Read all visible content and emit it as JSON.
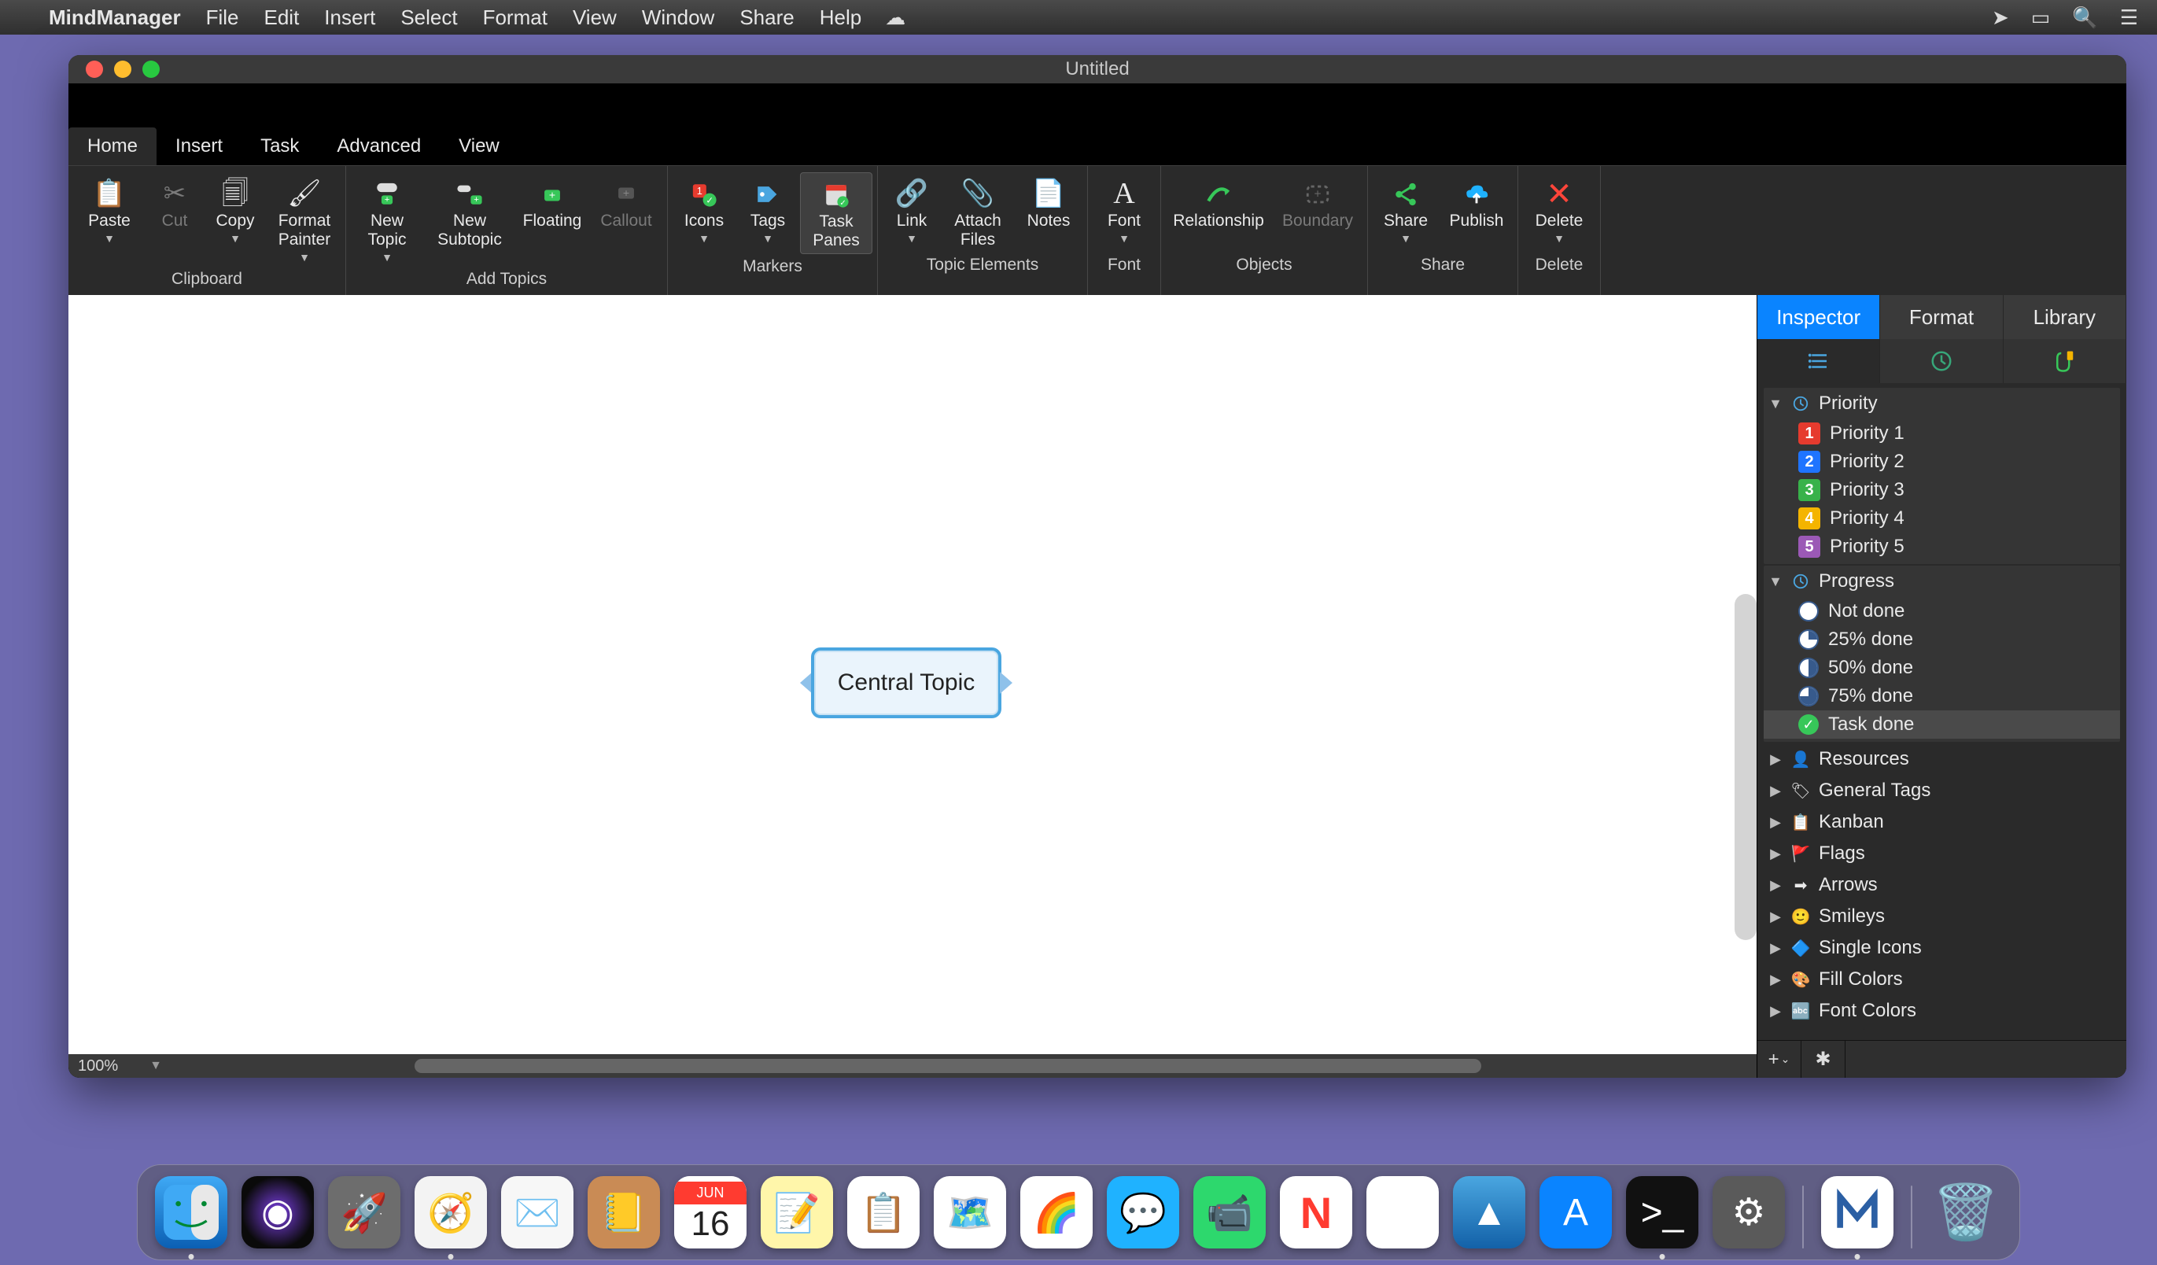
{
  "menubar": {
    "app_name": "MindManager",
    "items": [
      "File",
      "Edit",
      "Insert",
      "Select",
      "Format",
      "View",
      "Window",
      "Share",
      "Help"
    ]
  },
  "window": {
    "title": "Untitled",
    "zoom": "100%"
  },
  "ribbon_tabs": {
    "active": "Home",
    "items": [
      "Home",
      "Insert",
      "Task",
      "Advanced",
      "View"
    ]
  },
  "ribbon": {
    "clipboard": {
      "caption": "Clipboard",
      "paste": "Paste",
      "cut": "Cut",
      "copy": "Copy",
      "format_painter": "Format Painter"
    },
    "add_topics": {
      "caption": "Add Topics",
      "new_topic": "New Topic",
      "new_subtopic": "New Subtopic",
      "floating": "Floating",
      "callout": "Callout"
    },
    "markers": {
      "caption": "Markers",
      "icons": "Icons",
      "tags": "Tags",
      "task_panes": "Task Panes"
    },
    "topic_elements": {
      "caption": "Topic Elements",
      "link": "Link",
      "attach": "Attach Files",
      "notes": "Notes"
    },
    "font": {
      "caption": "Font",
      "font": "Font"
    },
    "objects": {
      "caption": "Objects",
      "relationship": "Relationship",
      "boundary": "Boundary"
    },
    "share": {
      "caption": "Share",
      "share": "Share",
      "publish": "Publish"
    },
    "delete": {
      "caption": "Delete",
      "delete": "Delete"
    }
  },
  "canvas": {
    "central_topic": "Central Topic"
  },
  "inspector": {
    "tabs": {
      "inspector": "Inspector",
      "format": "Format",
      "library": "Library"
    },
    "priority_group": {
      "label": "Priority",
      "items": [
        "Priority 1",
        "Priority 2",
        "Priority 3",
        "Priority 4",
        "Priority 5"
      ],
      "colors": [
        "#e63b2e",
        "#1f74ff",
        "#38b24a",
        "#f4b400",
        "#9b59b6"
      ]
    },
    "progress_group": {
      "label": "Progress",
      "items": [
        "Not done",
        "25% done",
        "50% done",
        "75% done",
        "Task done"
      ]
    },
    "collapsed": [
      "Resources",
      "General Tags",
      "Kanban",
      "Flags",
      "Arrows",
      "Smileys",
      "Single Icons",
      "Fill Colors",
      "Font Colors"
    ]
  },
  "dock": {
    "items": [
      {
        "name": "finder",
        "bg": "linear-gradient(#3fa9f5,#0b5fb3)",
        "glyph": "",
        "running": true
      },
      {
        "name": "siri",
        "bg": "radial-gradient(circle at 50% 50%, #7b3fe4 0%, #0a0a0a 70%)",
        "glyph": "◉"
      },
      {
        "name": "launchpad",
        "bg": "#6d6d6d",
        "glyph": "🚀"
      },
      {
        "name": "safari",
        "bg": "#f3f3f3",
        "glyph": "🧭",
        "running": true
      },
      {
        "name": "mail",
        "bg": "#f7f7f7",
        "glyph": "✉️"
      },
      {
        "name": "contacts",
        "bg": "#c98b55",
        "glyph": "📒"
      },
      {
        "name": "calendar",
        "bg": "#ffffff",
        "glyph": "",
        "running": false
      },
      {
        "name": "notes",
        "bg": "#fff6aa",
        "glyph": "📝"
      },
      {
        "name": "reminders",
        "bg": "#ffffff",
        "glyph": "📋"
      },
      {
        "name": "maps",
        "bg": "#ffffff",
        "glyph": "🗺️"
      },
      {
        "name": "photos",
        "bg": "#ffffff",
        "glyph": "🌈"
      },
      {
        "name": "messages",
        "bg": "#1fb2ff",
        "glyph": "💬"
      },
      {
        "name": "facetime",
        "bg": "#2dd86d",
        "glyph": "📹"
      },
      {
        "name": "news",
        "bg": "#ffffff",
        "glyph": "N"
      },
      {
        "name": "music",
        "bg": "#ffffff",
        "glyph": "♪"
      },
      {
        "name": "photos2",
        "bg": "linear-gradient(#4aa6e0,#1361a8)",
        "glyph": "▲"
      },
      {
        "name": "appstore",
        "bg": "#0a84ff",
        "glyph": "A"
      },
      {
        "name": "terminal",
        "bg": "#111",
        "glyph": ">_",
        "running": true
      },
      {
        "name": "settings",
        "bg": "#5a5a5a",
        "glyph": "⚙"
      }
    ],
    "pinned": [
      {
        "name": "mindmanager",
        "bg": "#ffffff",
        "glyph": "M",
        "running": true
      }
    ],
    "trash": {
      "name": "trash",
      "bg": "transparent",
      "glyph": "🗑️"
    },
    "calendar": {
      "month": "JUN",
      "day": "16"
    }
  }
}
